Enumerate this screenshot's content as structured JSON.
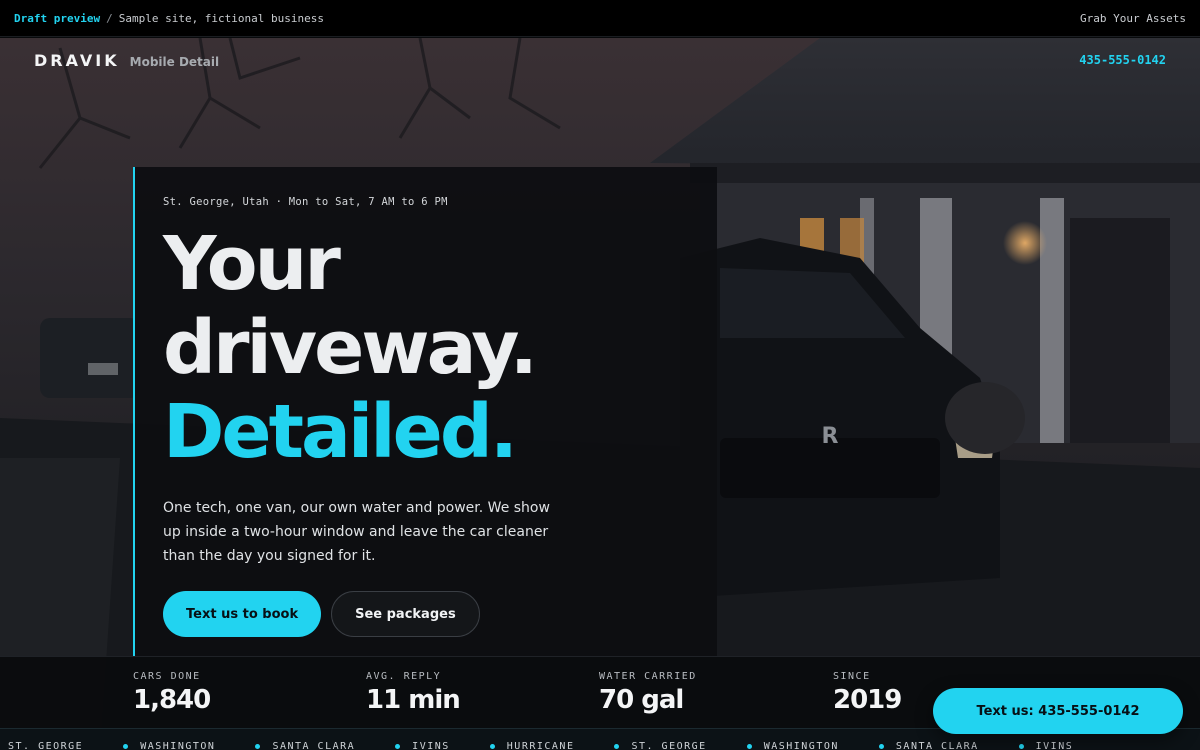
{
  "preview_bar": {
    "draft_label": "Draft preview",
    "separator": "/",
    "note": "Sample site, fictional business",
    "assets_link": "Grab Your Assets"
  },
  "header": {
    "brand": "DRAVIK",
    "brand_sub": "Mobile Detail",
    "phone": "435-555-0142"
  },
  "hero": {
    "meta": "St. George, Utah · Mon to Sat, 7 AM to 6 PM",
    "headline_line1": "Your",
    "headline_line2": "driveway.",
    "headline_line3": "Detailed.",
    "lede": "One tech, one van, our own water and power. We show up inside a two-hour window and leave the car cleaner than the day you signed for it.",
    "primary_cta": "Text us to book",
    "secondary_cta": "See packages"
  },
  "stats": [
    {
      "label": "CARS DONE",
      "value": "1,840"
    },
    {
      "label": "AVG. REPLY",
      "value": "11 min"
    },
    {
      "label": "WATER CARRIED",
      "value": "70 gal"
    },
    {
      "label": "SINCE",
      "value": "2019"
    }
  ],
  "floating_cta": "Text us: 435-555-0142",
  "ticker": [
    "ST. GEORGE",
    "WASHINGTON",
    "SANTA CLARA",
    "IVINS",
    "HURRICANE",
    "ST. GEORGE",
    "WASHINGTON",
    "SANTA CLARA",
    "IVINS"
  ],
  "colors": {
    "accent": "#22d3f0",
    "background": "#07090b",
    "card": "#0d0e11"
  }
}
